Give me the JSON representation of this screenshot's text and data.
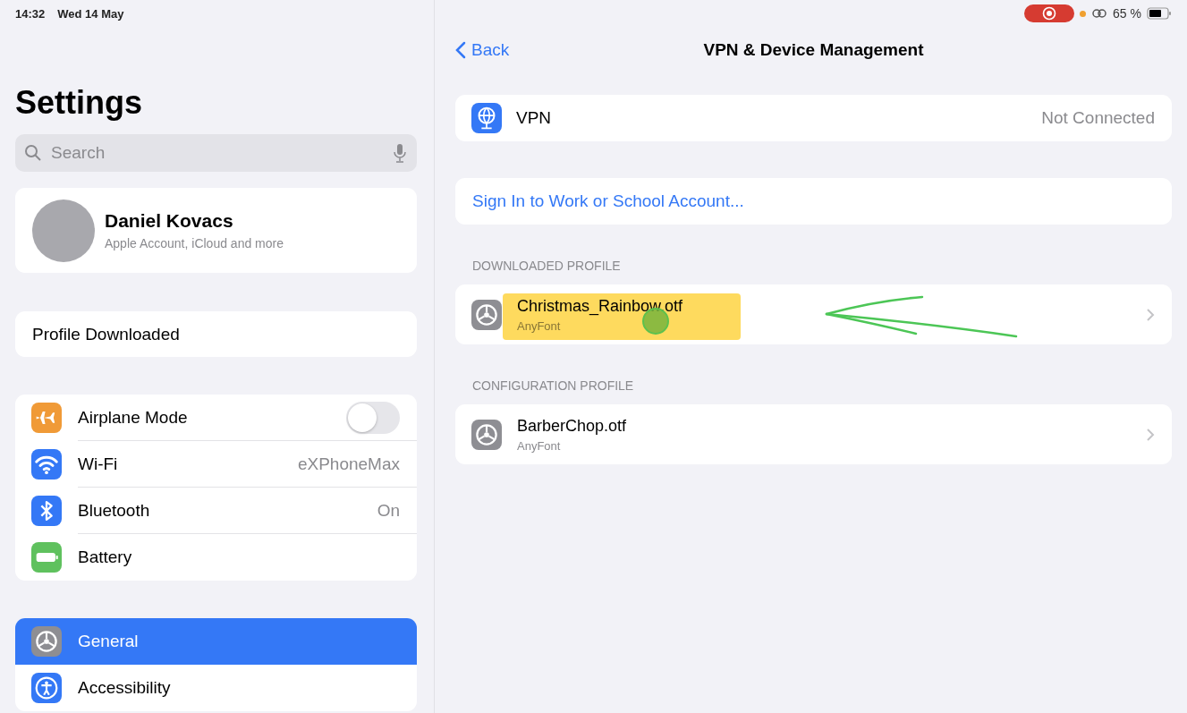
{
  "status_bar": {
    "time": "14:32",
    "date": "Wed 14 May",
    "battery_percent": "65 %",
    "recording": true
  },
  "sidebar": {
    "title": "Settings",
    "search": {
      "placeholder": "Search"
    },
    "account": {
      "name": "Daniel Kovacs",
      "subtitle": "Apple Account, iCloud and more"
    },
    "notice": "Profile Downloaded",
    "groups": [
      [
        {
          "label": "Airplane Mode",
          "kind": "toggle",
          "color": "#f09a37",
          "on": false,
          "selected": false
        },
        {
          "label": "Wi-Fi",
          "kind": "value",
          "color": "#3478f6",
          "value": "eXPhoneMax",
          "selected": false
        },
        {
          "label": "Bluetooth",
          "kind": "value",
          "color": "#3478f6",
          "value": "On",
          "selected": false
        },
        {
          "label": "Battery",
          "kind": "plain",
          "color": "#5fc15e",
          "selected": false
        }
      ],
      [
        {
          "label": "General",
          "kind": "plain",
          "color": "#8e8e93",
          "selected": true
        },
        {
          "label": "Accessibility",
          "kind": "plain",
          "color": "#3478f6",
          "selected": false
        }
      ]
    ]
  },
  "detail": {
    "back": "Back",
    "title": "VPN & Device Management",
    "vpn": {
      "label": "VPN",
      "status": "Not Connected"
    },
    "sign_in": "Sign In to Work or School Account...",
    "sections": [
      {
        "header": "DOWNLOADED PROFILE",
        "profiles": [
          {
            "name": "Christmas_Rainbow.otf",
            "subtitle": "AnyFont",
            "annotated": true
          }
        ]
      },
      {
        "header": "CONFIGURATION PROFILE",
        "profiles": [
          {
            "name": "BarberChop.otf",
            "subtitle": "AnyFont",
            "annotated": false
          }
        ]
      }
    ]
  }
}
